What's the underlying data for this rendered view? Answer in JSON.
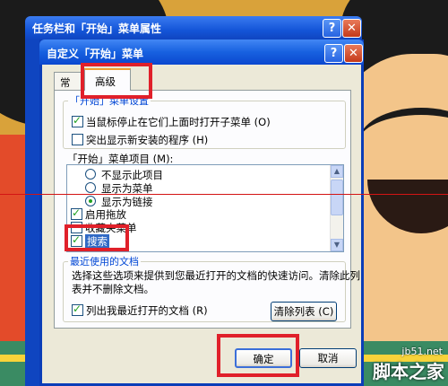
{
  "outer_window": {
    "title": "任务栏和「开始」菜单属性"
  },
  "dialog": {
    "title": "自定义「开始」菜单",
    "help_glyph": "?",
    "close_glyph": "✕"
  },
  "tabs": [
    {
      "label": "常规"
    },
    {
      "label": "高级"
    }
  ],
  "start_menu_settings": {
    "group_label": "「开始」菜单设置",
    "open_submenu_label": "当鼠标停止在它们上面时打开子菜单 (O)",
    "open_submenu_checked": true,
    "highlight_new_label": "突出显示新安装的程序 (H)",
    "highlight_new_checked": false
  },
  "start_menu_items": {
    "label": "「开始」菜单项目 (M):",
    "items": [
      {
        "type": "radio",
        "label": "不显示此项目",
        "checked": false
      },
      {
        "type": "radio",
        "label": "显示为菜单",
        "checked": false
      },
      {
        "type": "radio",
        "label": "显示为链接",
        "checked": true
      },
      {
        "type": "checkbox",
        "label": "启用拖放",
        "checked": true
      },
      {
        "type": "checkbox",
        "label": "收藏夹菜单",
        "checked": false
      },
      {
        "type": "checkbox",
        "label": "搜索",
        "checked": true
      }
    ]
  },
  "recent_docs": {
    "group_label": "最近使用的文档",
    "description_line1": "选择这些选项来提供到您最近打开的文档的快速访问。清除此列",
    "description_line2": "表并不删除文档。",
    "list_recent_label": "列出我最近打开的文档 (R)",
    "list_recent_checked": true,
    "clear_button": "清除列表 (C)"
  },
  "buttons": {
    "ok": "确定",
    "cancel": "取消"
  },
  "watermark": {
    "site": "jb51.net",
    "brand": "脚本之家"
  },
  "colors": {
    "highlight_box": "#e0202a",
    "title_bar": "#0b47cf",
    "selection": "#316ac5"
  }
}
